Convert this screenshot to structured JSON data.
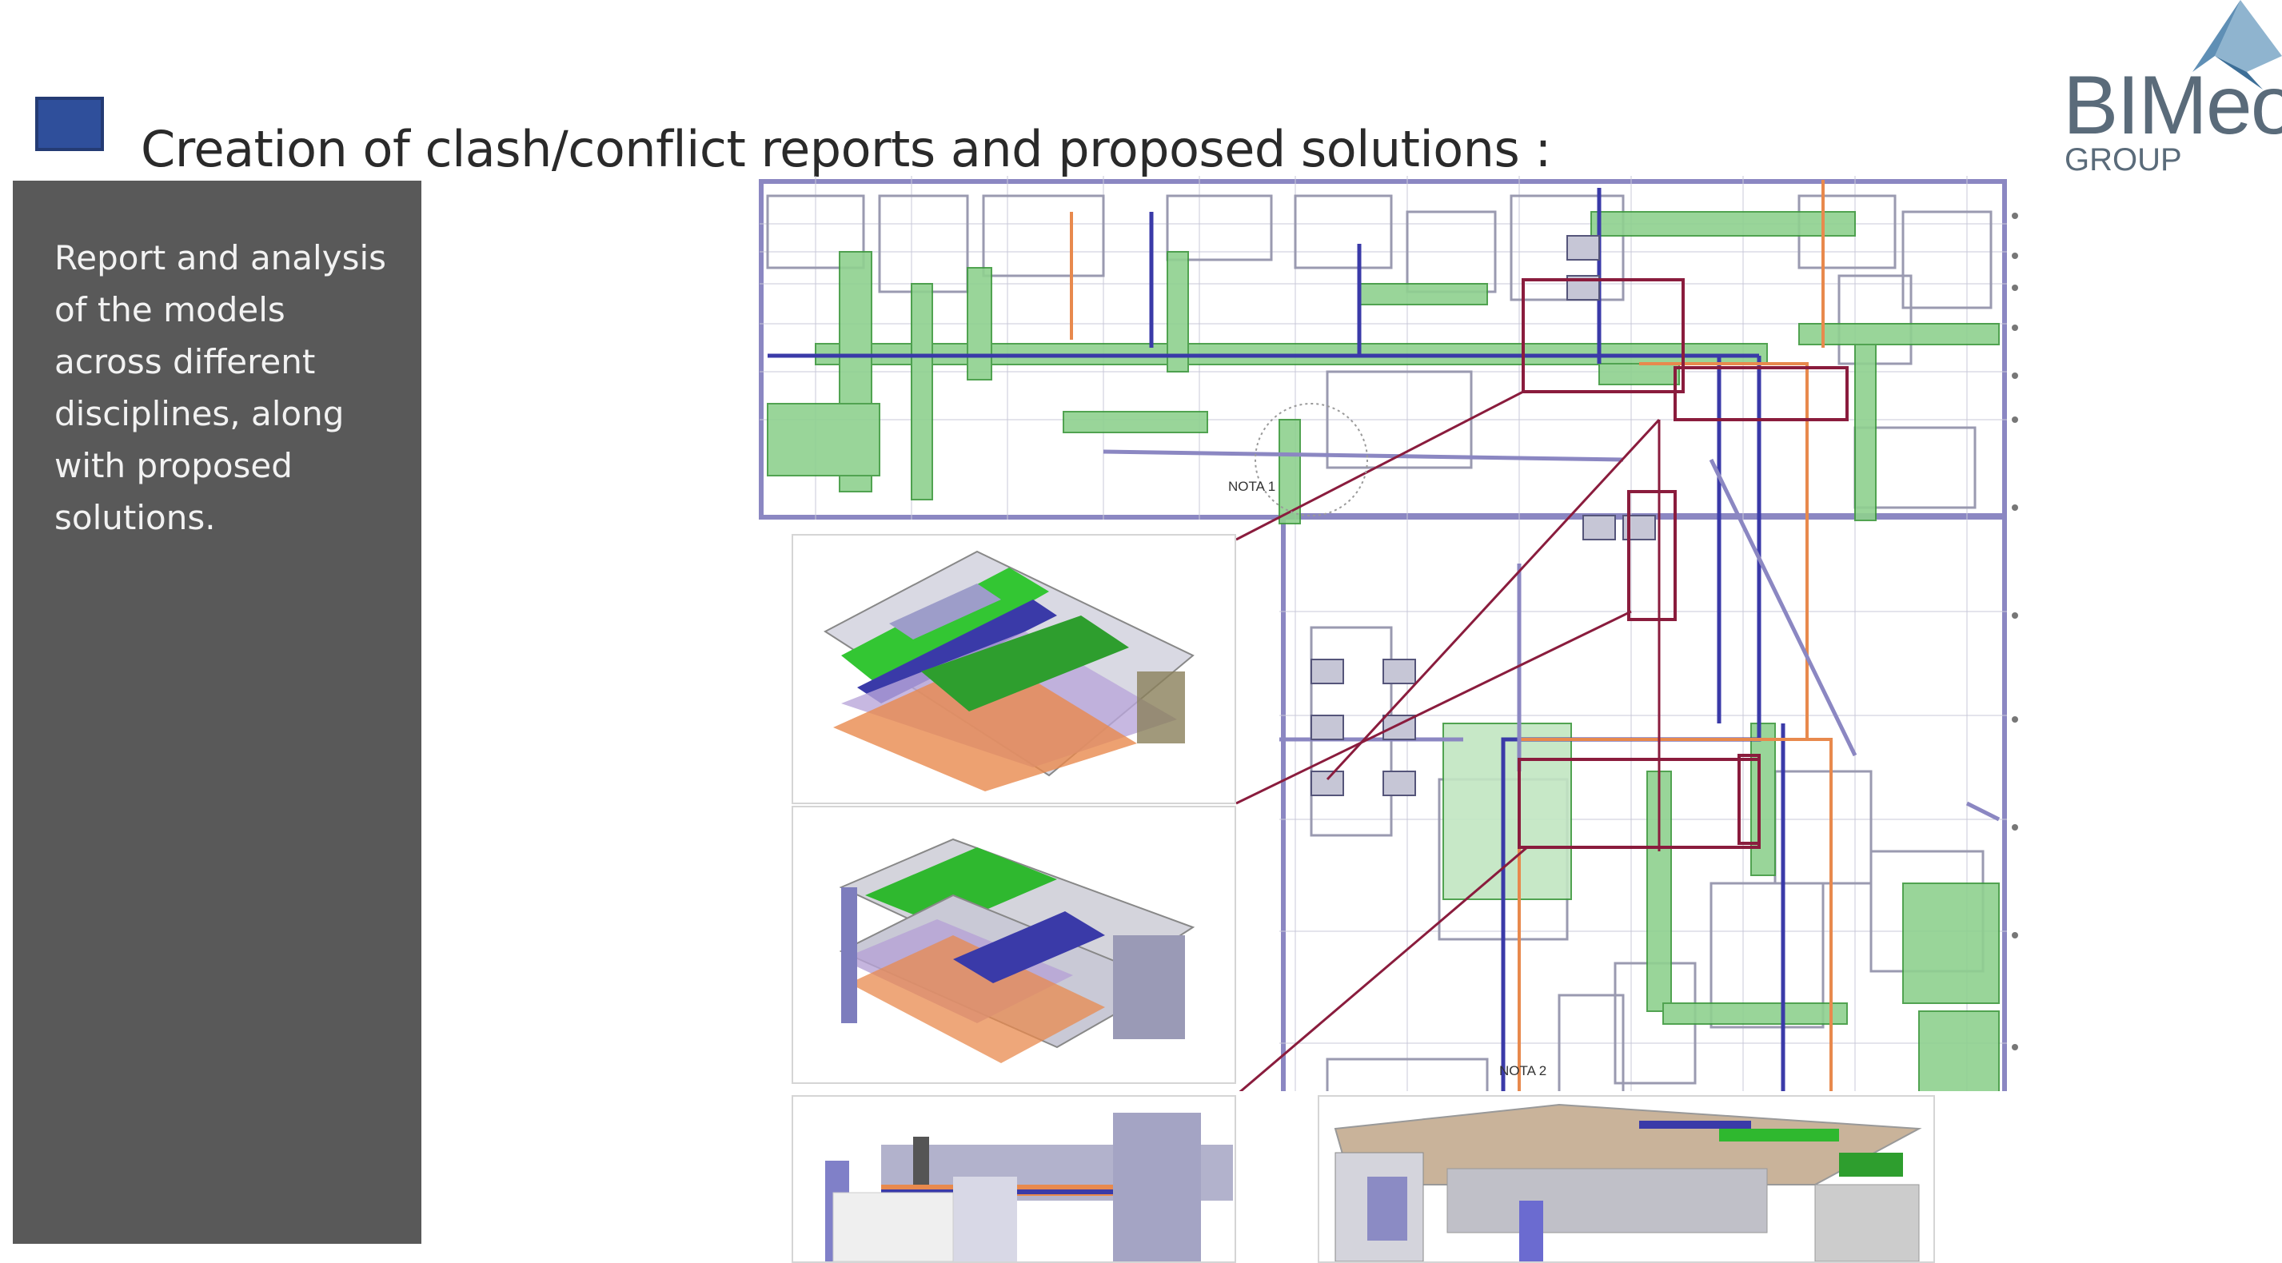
{
  "slide": {
    "title": "Creation of clash/conflict reports and proposed solutions :",
    "description": "Report and analysis of the models across different disciplines, along with proposed solutions.",
    "accent_color": "#2f4f9b",
    "panel_color": "#595959"
  },
  "logo": {
    "name": "BIMeo",
    "subtitle": "GROUP",
    "icon": "triangle-logo-icon"
  },
  "drawing": {
    "note_1": "NOTA 1",
    "note_2": "NOTA 2",
    "colors": {
      "wall": "#8b87c2",
      "duct": "#4caf50",
      "pipe_blue": "#3a3aa8",
      "pipe_orange": "#e8894d",
      "callout": "#8a1c3d"
    }
  }
}
